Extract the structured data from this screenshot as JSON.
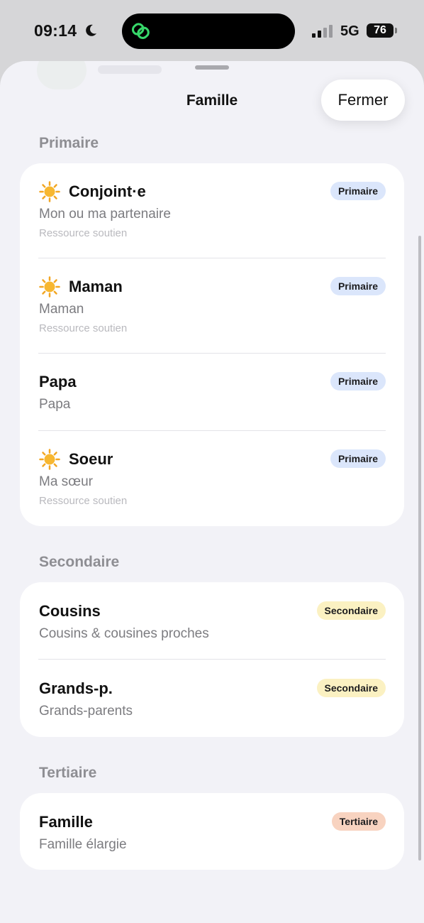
{
  "status_bar": {
    "time": "09:14",
    "network": "5G",
    "battery": "76"
  },
  "sheet": {
    "title": "Famille",
    "close_label": "Fermer"
  },
  "sections": [
    {
      "header": "Primaire",
      "items": [
        {
          "title": "Conjoint·e",
          "subtitle": "Mon ou ma partenaire",
          "note": "Ressource soutien",
          "badge": "Primaire",
          "icon": "sun-icon"
        },
        {
          "title": "Maman",
          "subtitle": "Maman",
          "note": "Ressource soutien",
          "badge": "Primaire",
          "icon": "sun-icon"
        },
        {
          "title": "Papa",
          "subtitle": "Papa",
          "note": "",
          "badge": "Primaire",
          "icon": ""
        },
        {
          "title": "Soeur",
          "subtitle": "Ma sœur",
          "note": "Ressource soutien",
          "badge": "Primaire",
          "icon": "sun-icon"
        }
      ]
    },
    {
      "header": "Secondaire",
      "items": [
        {
          "title": "Cousins",
          "subtitle": "Cousins & cousines proches",
          "badge": "Secondaire"
        },
        {
          "title": "Grands-p.",
          "subtitle": "Grands-parents",
          "badge": "Secondaire"
        }
      ]
    },
    {
      "header": "Tertiaire",
      "items": [
        {
          "title": "Famille",
          "subtitle": "Famille élargie",
          "badge": "Tertiaire"
        }
      ]
    }
  ],
  "colors": {
    "primaire_badge": "#dbe6fb",
    "secondaire_badge": "#fbf1c2",
    "tertiaire_badge": "#f8d3c0",
    "sheet_background": "#f2f2f7"
  }
}
